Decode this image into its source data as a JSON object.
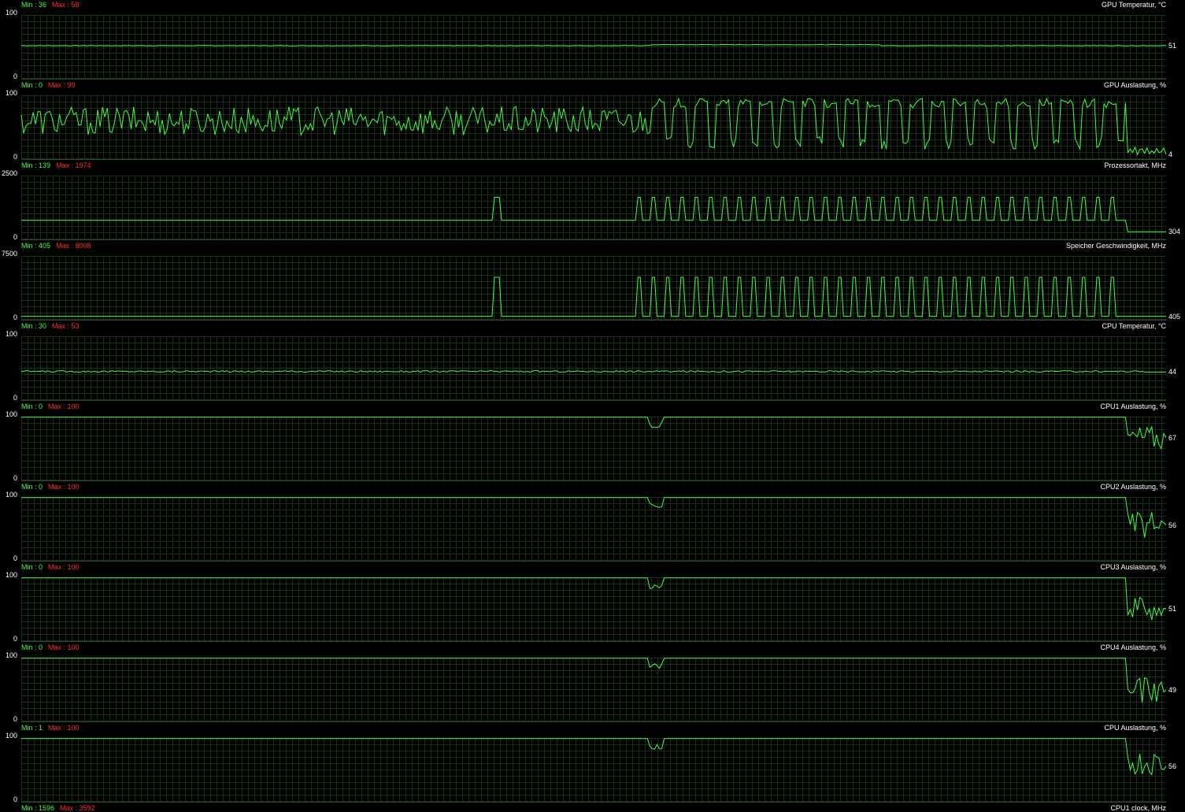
{
  "colors": {
    "background": "#000000",
    "grid": "#173017",
    "trace": "#3fff3f",
    "min_text": "#3fff3f",
    "max_text": "#ff2a2a",
    "label_text": "#ffffff"
  },
  "panels": [
    {
      "title": "GPU Temperatur, °C",
      "min_text": "Min : 36",
      "max_text": "Max : 58",
      "y_top": "100",
      "y_bottom": "0",
      "current_text": "51",
      "range": [
        0,
        100
      ],
      "current": 51,
      "profile": "flat",
      "base": 52
    },
    {
      "title": "GPU Auslastung, %",
      "min_text": "Min : 0",
      "max_text": "Max : 99",
      "y_top": "100",
      "y_bottom": "0",
      "current_text": "4",
      "range": [
        0,
        100
      ],
      "current": 4,
      "profile": "noisy",
      "base": 60
    },
    {
      "title": "Prozessortakt, MHz",
      "min_text": "Min : 139",
      "max_text": "Max : 1974",
      "y_top": "2500",
      "y_bottom": "0",
      "current_text": "304",
      "range": [
        0,
        2500
      ],
      "current": 304,
      "profile": "spiky",
      "base": 750,
      "peak": 1650
    },
    {
      "title": "Speicher Geschwindigkeit, MHz",
      "min_text": "Min : 405",
      "max_text": "Max : 8008",
      "y_top": "7500",
      "y_bottom": "0",
      "current_text": "405",
      "range": [
        0,
        7500
      ],
      "current": 405,
      "profile": "spiky",
      "base": 405,
      "peak": 5000
    },
    {
      "title": "CPU Temperatur, °C",
      "min_text": "Min : 30",
      "max_text": "Max : 53",
      "y_top": "100",
      "y_bottom": "0",
      "current_text": "44",
      "range": [
        0,
        100
      ],
      "current": 44,
      "profile": "flatnoisy",
      "base": 45
    },
    {
      "title": "CPU1 Auslastung, %",
      "min_text": "Min : 0",
      "max_text": "Max : 100",
      "y_top": "100",
      "y_bottom": "0",
      "current_text": "67",
      "range": [
        0,
        100
      ],
      "current": 67,
      "profile": "cpu",
      "base": 100
    },
    {
      "title": "CPU2 Auslastung, %",
      "min_text": "Min : 0",
      "max_text": "Max : 100",
      "y_top": "100",
      "y_bottom": "0",
      "current_text": "56",
      "range": [
        0,
        100
      ],
      "current": 56,
      "profile": "cpu",
      "base": 100
    },
    {
      "title": "CPU3 Auslastung, %",
      "min_text": "Min : 0",
      "max_text": "Max : 100",
      "y_top": "100",
      "y_bottom": "0",
      "current_text": "51",
      "range": [
        0,
        100
      ],
      "current": 51,
      "profile": "cpu",
      "base": 100
    },
    {
      "title": "CPU4 Auslastung, %",
      "min_text": "Min : 0",
      "max_text": "Max : 100",
      "y_top": "100",
      "y_bottom": "0",
      "current_text": "49",
      "range": [
        0,
        100
      ],
      "current": 49,
      "profile": "cpu",
      "base": 100
    },
    {
      "title": "CPU Auslastung, %",
      "min_text": "Min : 1",
      "max_text": "Max : 100",
      "y_top": "100",
      "y_bottom": "0",
      "current_text": "56",
      "range": [
        0,
        100
      ],
      "current": 56,
      "profile": "cpu",
      "base": 100
    },
    {
      "title": "CPU1 clock, MHz",
      "min_text": "Min : 1596",
      "max_text": "Max : 3592",
      "profile": "none"
    }
  ]
}
